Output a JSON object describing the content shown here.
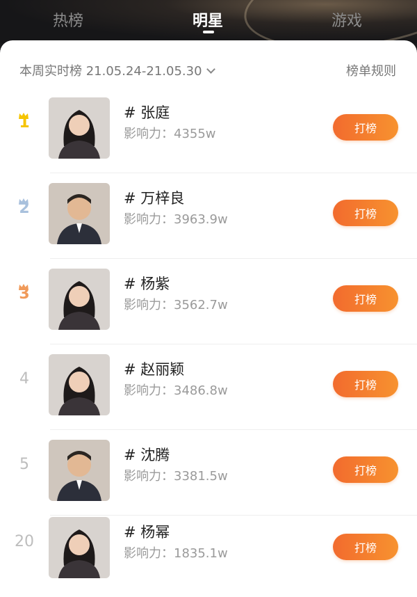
{
  "tabs": [
    {
      "label": "热榜",
      "active": false
    },
    {
      "label": "明星",
      "active": true
    },
    {
      "label": "游戏",
      "active": false
    }
  ],
  "subheader": {
    "period": "本周实时榜 21.05.24-21.05.30",
    "rules": "榜单规则"
  },
  "colors": {
    "accent": "#f47c2c",
    "rank_gold": "#f5c400",
    "rank_silver": "#a9c1dd",
    "rank_bronze": "#f09a5a"
  },
  "rows": [
    {
      "rank": "1",
      "crown": "gold",
      "name": "# 张庭",
      "influence": "影响力：4355w",
      "button": "打榜",
      "avatar": "avatar-woman-icon"
    },
    {
      "rank": "2",
      "crown": "silver",
      "name": "# 万梓良",
      "influence": "影响力：3963.9w",
      "button": "打榜",
      "avatar": "avatar-man-icon"
    },
    {
      "rank": "3",
      "crown": "bronze",
      "name": "# 杨紫",
      "influence": "影响力：3562.7w",
      "button": "打榜",
      "avatar": "avatar-woman-icon"
    },
    {
      "rank": "4",
      "crown": "",
      "name": "# 赵丽颖",
      "influence": "影响力：3486.8w",
      "button": "打榜",
      "avatar": "avatar-woman-icon"
    },
    {
      "rank": "5",
      "crown": "",
      "name": "# 沈腾",
      "influence": "影响力：3381.5w",
      "button": "打榜",
      "avatar": "avatar-man-icon"
    },
    {
      "rank": "20",
      "crown": "",
      "name": "# 杨幂",
      "influence": "影响力：1835.1w",
      "button": "打榜",
      "avatar": "avatar-woman-icon"
    }
  ]
}
